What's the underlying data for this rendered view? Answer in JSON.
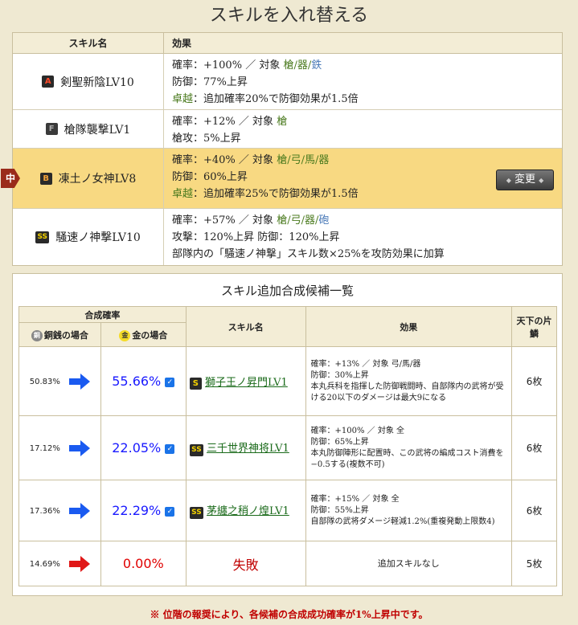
{
  "page_title": "スキルを入れ替える",
  "current": {
    "header": {
      "name": "スキル名",
      "effect": "効果"
    },
    "rows": [
      {
        "rank": "A",
        "name": "剣聖新陰LV10",
        "lines": [
          {
            "prefix": "確率：+100% ／ 対象 ",
            "targets": "槍/器/",
            "targets2": "鉄"
          },
          {
            "text": "防御：77%上昇"
          },
          {
            "excel": "卓越",
            "text": "：追加確率20%で防御効果が1.5倍"
          }
        ]
      },
      {
        "rank": "F",
        "name": "槍隊襲撃LV1",
        "lines": [
          {
            "prefix": "確率：+12% ／ 対象 ",
            "targets": "槍",
            "targets2": ""
          },
          {
            "text": "槍攻：5%上昇"
          }
        ]
      },
      {
        "rank": "B",
        "name": "凍土ノ女神LV8",
        "selected": true,
        "marker": "中",
        "button": "変更",
        "lines": [
          {
            "prefix": "確率：+40% ／ 対象 ",
            "targets": "槍/弓/馬/器",
            "targets2": ""
          },
          {
            "text": "防御：60%上昇"
          },
          {
            "excel": "卓越",
            "text": "：追加確率25%で防御効果が1.5倍"
          }
        ]
      },
      {
        "rank": "SS",
        "name": "騒速ノ神撃LV10",
        "lines": [
          {
            "prefix": "確率：+57% ／ 対象 ",
            "targets": "槍/弓/器/",
            "targets2": "砲"
          },
          {
            "text": "攻撃：120%上昇 防御：120%上昇"
          },
          {
            "text": "部隊内の「騒速ノ神撃」スキル数×25%を攻防効果に加算"
          }
        ]
      }
    ]
  },
  "candidates": {
    "title": "スキル追加合成候補一覧",
    "header": {
      "rate": "合成確率",
      "copper": "銅銭の場合",
      "gold": "金の場合",
      "copper_coin": "銅",
      "gold_coin": "金",
      "name": "スキル名",
      "effect": "効果",
      "count": "天下の片鱗"
    },
    "rows": [
      {
        "old": "50.83%",
        "new": "55.66%",
        "rank": "S",
        "name": "獅子王ノ昇門LV1",
        "count": "6枚",
        "eff": [
          "確率：+13% ／ 対象 弓/馬/器",
          "防御：30%上昇",
          "本丸兵科を指揮した防御戦闘時、自部隊内の武将が受ける20以下のダメージは最大9になる"
        ]
      },
      {
        "old": "17.12%",
        "new": "22.05%",
        "rank": "SS",
        "name": "三千世界神将LV1",
        "count": "6枚",
        "eff": [
          "確率：+100% ／ 対象 全",
          "防御：65%上昇",
          "本丸防御陣形に配置時、この武将の編成コスト消費を−0.5する(複数不可)"
        ]
      },
      {
        "old": "17.36%",
        "new": "22.29%",
        "rank": "SS",
        "name": "茅纏之稍ノ煌LV1",
        "count": "6枚",
        "eff": [
          "確率：+15% ／ 対象 全",
          "防御：55%上昇",
          "自部隊の武将ダメージ軽減1.2%(重複発動上限数4)"
        ]
      },
      {
        "old": "14.69%",
        "new": "0.00%",
        "fail": "失敗",
        "count": "5枚",
        "eff": [
          "追加スキルなし"
        ]
      }
    ]
  },
  "footnote": "※ 位階の報奨により、各候補の合成成功確率が1%上昇中です。",
  "colors": {
    "accent_blue": "#1a1aff",
    "fail_red": "#e00000",
    "selected_row": "#f8d982"
  }
}
